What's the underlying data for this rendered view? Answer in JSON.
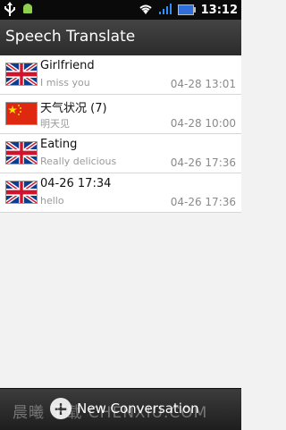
{
  "status": {
    "time": "13:12"
  },
  "app": {
    "title": "Speech Translate"
  },
  "conversations": [
    {
      "flag": "uk",
      "title": "Girlfriend",
      "subtitle": "I miss you",
      "time": "04-28 13:01"
    },
    {
      "flag": "china",
      "title": "天气状况 (7)",
      "subtitle": "明天见",
      "time": "04-28 10:00"
    },
    {
      "flag": "uk",
      "title": "Eating",
      "subtitle": "Really delicious",
      "time": "04-26 17:36"
    },
    {
      "flag": "uk",
      "title": "04-26 17:34",
      "subtitle": "hello",
      "time": "04-26 17:36"
    }
  ],
  "bottom": {
    "new_label": "New Conversation"
  },
  "watermark": "晨曦 下载 CHENXIU.COM",
  "colors": {
    "uk_blue": "#0b3d91",
    "uk_red": "#cf142b",
    "china_red": "#de2910",
    "china_yellow": "#ffde00"
  }
}
